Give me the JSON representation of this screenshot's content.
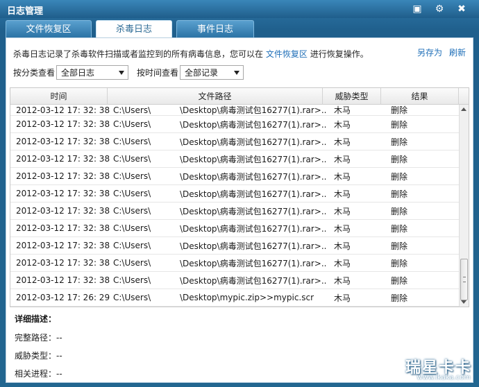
{
  "window": {
    "title": "日志管理"
  },
  "tabs": [
    {
      "label": "文件恢复区"
    },
    {
      "label": "杀毒日志"
    },
    {
      "label": "事件日志"
    }
  ],
  "info": {
    "text_before": "杀毒日志记录了杀毒软件扫描或者监控到的所有病毒信息，您可以在",
    "link": "文件恢复区",
    "text_after": "进行恢复操作。",
    "save_as": "另存为",
    "refresh": "刷新"
  },
  "filters": {
    "category_label": "按分类查看",
    "category_value": "全部日志",
    "time_label": "按时间查看",
    "time_value": "全部记录"
  },
  "table": {
    "headers": [
      "时间",
      "文件路径",
      "威胁类型",
      "结果"
    ],
    "rows": [
      {
        "time": "2012-03-12 17: 32: 38",
        "path_start": "C:\\Users\\",
        "path_end": "\\Desktop\\病毒测试包16277(1).rar>...",
        "type": "木马",
        "result": "删除"
      },
      {
        "time": "2012-03-12 17: 32: 38",
        "path_start": "C:\\Users\\",
        "path_end": "\\Desktop\\病毒测试包16277(1).rar>...",
        "type": "木马",
        "result": "删除"
      },
      {
        "time": "2012-03-12 17: 32: 38",
        "path_start": "C:\\Users\\",
        "path_end": "\\Desktop\\病毒测试包16277(1).rar>...",
        "type": "木马",
        "result": "删除"
      },
      {
        "time": "2012-03-12 17: 32: 38",
        "path_start": "C:\\Users\\",
        "path_end": "\\Desktop\\病毒测试包16277(1).rar>...",
        "type": "木马",
        "result": "删除"
      },
      {
        "time": "2012-03-12 17: 32: 38",
        "path_start": "C:\\Users\\",
        "path_end": "\\Desktop\\病毒测试包16277(1).rar>...",
        "type": "木马",
        "result": "删除"
      },
      {
        "time": "2012-03-12 17: 32: 38",
        "path_start": "C:\\Users\\",
        "path_end": "\\Desktop\\病毒测试包16277(1).rar>...",
        "type": "木马",
        "result": "删除"
      },
      {
        "time": "2012-03-12 17: 32: 38",
        "path_start": "C:\\Users\\",
        "path_end": "\\Desktop\\病毒测试包16277(1).rar>...",
        "type": "木马",
        "result": "删除"
      },
      {
        "time": "2012-03-12 17: 32: 38",
        "path_start": "C:\\Users\\",
        "path_end": "\\Desktop\\病毒测试包16277(1).rar>...",
        "type": "木马",
        "result": "删除"
      },
      {
        "time": "2012-03-12 17: 32: 38",
        "path_start": "C:\\Users\\",
        "path_end": "\\Desktop\\病毒测试包16277(1).rar>...",
        "type": "木马",
        "result": "删除"
      },
      {
        "time": "2012-03-12 17: 32: 38",
        "path_start": "C:\\Users\\",
        "path_end": "\\Desktop\\病毒测试包16277(1).rar>...",
        "type": "木马",
        "result": "删除"
      },
      {
        "time": "2012-03-12 17: 32: 38",
        "path_start": "C:\\Users\\",
        "path_end": "\\Desktop\\病毒测试包16277(1).rar>...",
        "type": "木马",
        "result": "删除"
      },
      {
        "time": "2012-03-12 17: 26: 29",
        "path_start": "C:\\Users\\",
        "path_end": "\\Desktop\\mypic.zip>>mypic.scr",
        "type": "木马",
        "result": "删除"
      }
    ]
  },
  "details": {
    "heading": "详细描述：",
    "full_path": "完整路径：--",
    "threat_type": "威胁类型：--",
    "related_process": "相关进程：--"
  },
  "watermark": {
    "brand": "瑞星卡卡",
    "url": "www.ikaka.com"
  },
  "icons": {
    "minimize": "minimize-icon",
    "settings": "gear-icon",
    "close": "close-icon"
  }
}
